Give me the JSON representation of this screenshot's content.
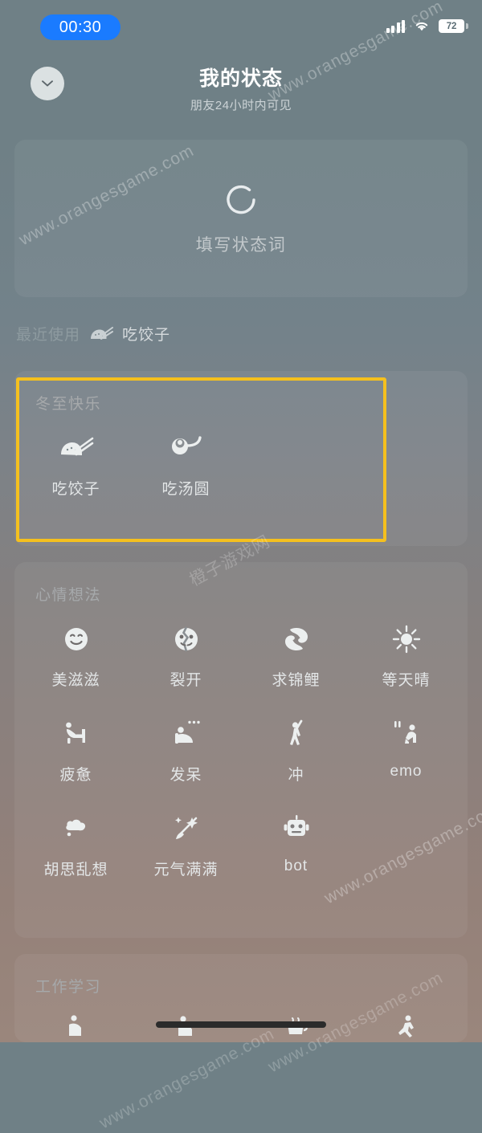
{
  "statusbar": {
    "time": "00:30",
    "battery_level": "72",
    "signal_icon": "signal-bars-icon",
    "wifi_icon": "wifi-icon",
    "battery_icon": "battery-icon"
  },
  "header": {
    "close_icon": "chevron-down-icon",
    "title": "我的状态",
    "subtitle": "朋友24小时内可见"
  },
  "status_card": {
    "icon": "status-ring-icon",
    "placeholder": "填写状态词"
  },
  "recent": {
    "label": "最近使用",
    "icon": "dumpling-icon",
    "name": "吃饺子"
  },
  "sections": [
    {
      "title": "冬至快乐",
      "items": [
        {
          "label": "吃饺子",
          "icon": "dumpling-icon"
        },
        {
          "label": "吃汤圆",
          "icon": "tangyuan-spoon-icon"
        }
      ]
    },
    {
      "title": "心情想法",
      "items": [
        {
          "label": "美滋滋",
          "icon": "smiley-face-icon"
        },
        {
          "label": "裂开",
          "icon": "cracked-face-icon"
        },
        {
          "label": "求锦鲤",
          "icon": "koi-fish-icon"
        },
        {
          "label": "等天晴",
          "icon": "sun-icon"
        },
        {
          "label": "疲惫",
          "icon": "tired-person-icon"
        },
        {
          "label": "发呆",
          "icon": "daydreaming-person-icon"
        },
        {
          "label": "冲",
          "icon": "cheering-person-icon"
        },
        {
          "label": "emo",
          "icon": "crouching-person-icon"
        },
        {
          "label": "胡思乱想",
          "icon": "thought-cloud-icon"
        },
        {
          "label": "元气满满",
          "icon": "magic-wand-icon"
        },
        {
          "label": "bot",
          "icon": "robot-head-icon"
        }
      ]
    },
    {
      "title": "工作学习",
      "items": [
        {
          "label": "",
          "icon": "person-study-icon"
        },
        {
          "label": "",
          "icon": "person-work-icon"
        },
        {
          "label": "",
          "icon": "coffee-cup-icon"
        },
        {
          "label": "",
          "icon": "person-run-icon"
        }
      ]
    }
  ],
  "colors": {
    "time_pill": "#1a7bff",
    "highlight_border": "#f5c01e",
    "title_text": "#ffffff",
    "section_title": "#a6a9ab"
  },
  "watermarks": [
    "www.orangesgame.com",
    "www.orangesgame.com",
    "www.orangesgame.com",
    "橙子游戏网"
  ]
}
